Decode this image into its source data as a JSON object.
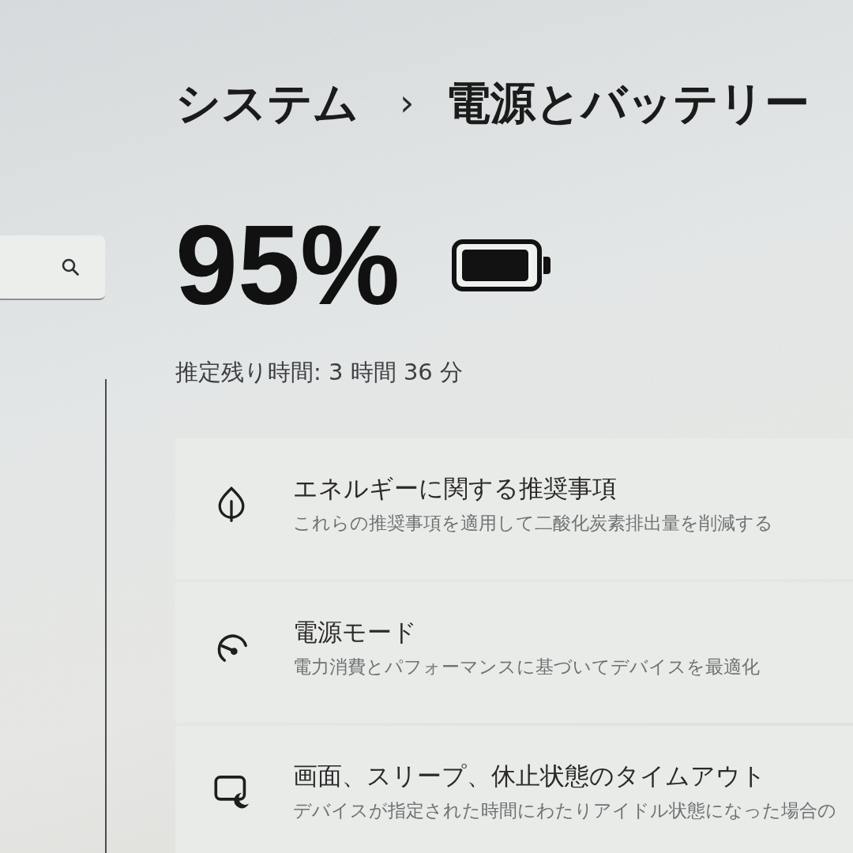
{
  "breadcrumb": {
    "items": [
      "システム",
      "電源とバッテリー"
    ],
    "separator": "›"
  },
  "battery": {
    "percent": "95%",
    "level": 0.95,
    "estimate": "推定残り時間: 3 時間 36 分"
  },
  "settings": [
    {
      "title": "エネルギーに関する推奨事項",
      "description": "これらの推奨事項を適用して二酸化炭素排出量を削減する"
    },
    {
      "title": "電源モード",
      "description": "電力消費とパフォーマンスに基づいてデバイスを最適化"
    },
    {
      "title": "画面、スリープ、休止状態のタイムアウト",
      "description": "デバイスが指定された時間にわたりアイドル状態になった場合の"
    }
  ]
}
